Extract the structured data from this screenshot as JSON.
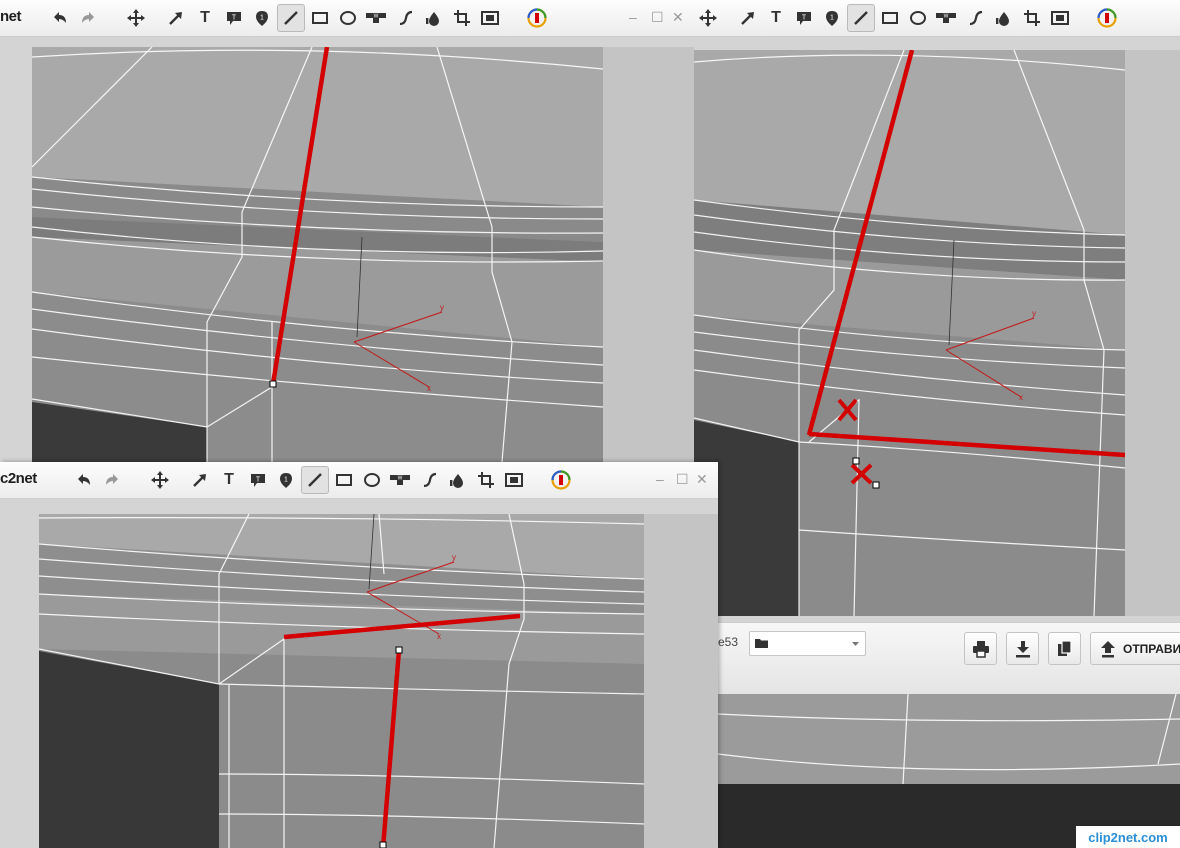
{
  "app": {
    "brand_left": "net",
    "brand_bottom": "c2net",
    "window_controls": {
      "minimize": "–",
      "maximize": "☐",
      "close": "✕"
    }
  },
  "toolbar": {
    "tools": [
      {
        "name": "undo",
        "icon": "undo-icon"
      },
      {
        "name": "redo",
        "icon": "redo-icon"
      },
      {
        "name": "move",
        "icon": "move-icon"
      },
      {
        "name": "arrow",
        "icon": "arrow-icon"
      },
      {
        "name": "text",
        "icon": "text-icon",
        "glyph": "T"
      },
      {
        "name": "callout",
        "icon": "callout-icon"
      },
      {
        "name": "marker",
        "icon": "marker-icon"
      },
      {
        "name": "line",
        "icon": "line-icon",
        "active": true
      },
      {
        "name": "rectangle",
        "icon": "rectangle-icon"
      },
      {
        "name": "ellipse",
        "icon": "ellipse-icon"
      },
      {
        "name": "stamp",
        "icon": "stamp-icon"
      },
      {
        "name": "freehand",
        "icon": "freehand-icon"
      },
      {
        "name": "blur",
        "icon": "blur-icon"
      },
      {
        "name": "crop",
        "icon": "crop-icon"
      },
      {
        "name": "resize",
        "icon": "resize-icon"
      },
      {
        "name": "color",
        "icon": "color-icon"
      }
    ]
  },
  "share_bar": {
    "partial_field": "e53",
    "folder_value": "",
    "buttons": [
      {
        "name": "print",
        "icon": "print-icon"
      },
      {
        "name": "download",
        "icon": "download-icon"
      },
      {
        "name": "copy",
        "icon": "copy-icon"
      }
    ],
    "send_label": "ОТПРАВИ"
  },
  "watermark": {
    "text": "clip2net.com"
  },
  "colors": {
    "annotation_red": "#d40000",
    "mesh_light": "#a4a4a4",
    "mesh_mid": "#8f8f8f",
    "mesh_dark": "#3a3a3a",
    "wire": "#ffffff",
    "toolbar_bg": "#f4f4f4"
  }
}
